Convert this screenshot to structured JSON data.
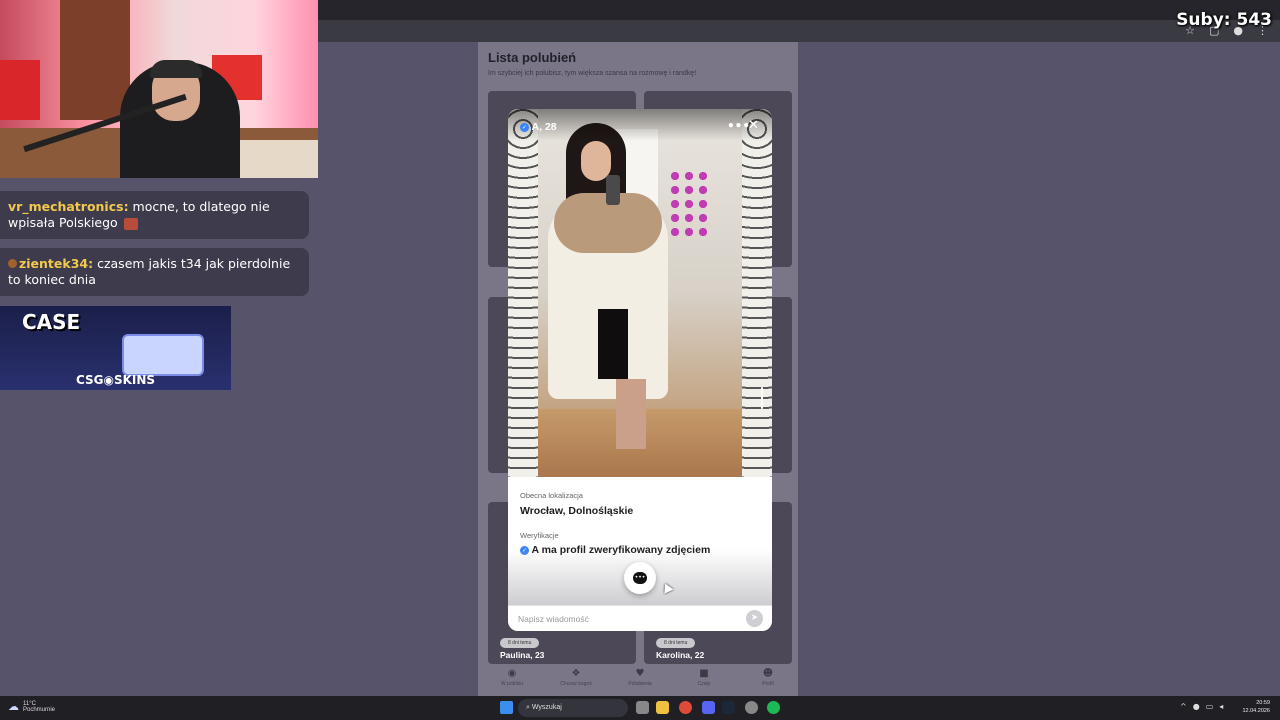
{
  "overlay": {
    "subs_text": "Suby: 543"
  },
  "chat": [
    {
      "user": "vr_mechatronics:",
      "text": " mocne, to dlatego nie wpisała Polskiego"
    },
    {
      "user": "zientek34:",
      "text": " czasem jakis t34 jak pierdolnie to koniec dnia"
    }
  ],
  "ad": {
    "headline": "CASE",
    "brand": "CSG◉SKINS"
  },
  "app": {
    "title": "Lista polubień",
    "subtitle": "Im szybciej ich polubisz, tym większa szansa na rozmowę i randkę!",
    "cards": [
      {
        "name": "Paulina, 23",
        "pill": "8 dni temu"
      },
      {
        "name": "Karolina, 22",
        "pill": "8 dni temu"
      }
    ],
    "nav": [
      {
        "label": "W pobliżu",
        "icon": "◉"
      },
      {
        "label": "Chcesz kogoś",
        "icon": "❖"
      },
      {
        "label": "Polubienia",
        "icon": "♥"
      },
      {
        "label": "Czaty",
        "icon": "■"
      },
      {
        "label": "Profil",
        "icon": "☻"
      }
    ]
  },
  "profile": {
    "name": "A, 28",
    "location_label": "Obecna lokalizacja",
    "location": "Wrocław, Dolnośląskie",
    "verification_label": "Weryfikacje",
    "verification": "A ma profil zweryfikowany zdjęciem",
    "message_placeholder": "Napisz wiadomość"
  },
  "taskbar": {
    "temperature": "11°C",
    "weather": "Pochmurnie",
    "search": "Wyszukaj",
    "time": "20:59",
    "date": "12.04.2026"
  },
  "colors": {
    "accent": "#3b82f6",
    "chat_username": "#f2c94c"
  }
}
